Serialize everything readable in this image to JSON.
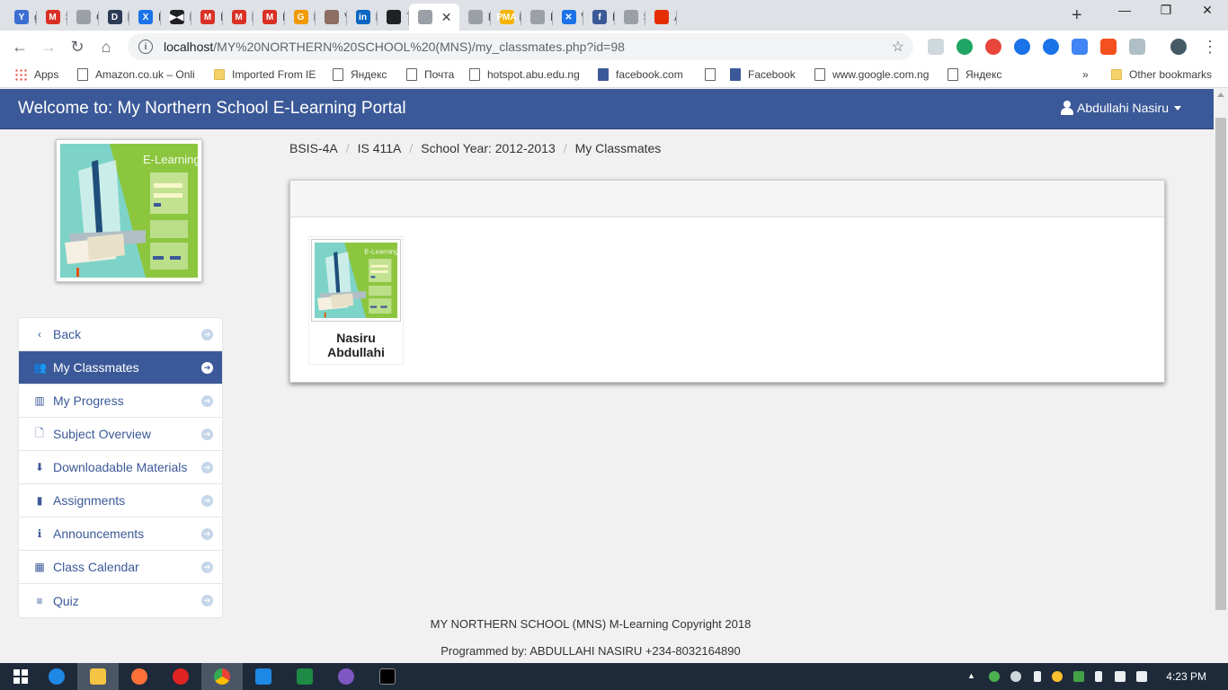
{
  "browser": {
    "tabs": [
      {
        "label": "go",
        "color": "#3c6fd1",
        "glyph": "Y"
      },
      {
        "label": "Se",
        "color": "#d93025",
        "glyph": "M"
      },
      {
        "label": "Gri",
        "color": "#9aa0a6",
        "glyph": ""
      },
      {
        "label": "De",
        "color": "#2b3a55",
        "glyph": "D"
      },
      {
        "label": "Ho",
        "color": "#1a73e8",
        "glyph": "X"
      },
      {
        "label": "Ma",
        "color": "#202124",
        "glyph": "▶◀"
      },
      {
        "label": "Inb",
        "color": "#d93025",
        "glyph": "M"
      },
      {
        "label": "Inb",
        "color": "#d93025",
        "glyph": "M"
      },
      {
        "label": "Inb",
        "color": "#d93025",
        "glyph": "M"
      },
      {
        "label": "Fre",
        "color": "#f29900",
        "glyph": "G"
      },
      {
        "label": "VB",
        "color": "#8d6e63",
        "glyph": ""
      },
      {
        "label": "No",
        "color": "#0a66c2",
        "glyph": "in"
      },
      {
        "label": "To",
        "color": "#202124",
        "glyph": ""
      },
      {
        "label": "",
        "color": "#9aa0a6",
        "glyph": ""
      },
      {
        "label": "log",
        "color": "#9aa0a6",
        "glyph": ""
      },
      {
        "label": "loc",
        "color": "#f4b400",
        "glyph": "PMA"
      },
      {
        "label": "MY",
        "color": "#9aa0a6",
        "glyph": ""
      },
      {
        "label": "WA",
        "color": "#1a73e8",
        "glyph": "✕"
      },
      {
        "label": "Fac",
        "color": "#3b5998",
        "glyph": "f"
      },
      {
        "label": "Sca",
        "color": "#9aa0a6",
        "glyph": ""
      },
      {
        "label": "Ali",
        "color": "#e62e04",
        "glyph": ""
      }
    ],
    "new_tab": "+",
    "minimize": "—",
    "restore": "❐",
    "close": "✕",
    "url_host": "localhost",
    "url_path": "/MY%20NORTHERN%20SCHOOL%20(MNS)/my_classmates.php?id=98",
    "bookmarks": [
      {
        "label": "Apps",
        "kind": "apps"
      },
      {
        "label": "Amazon.co.uk – Onli",
        "kind": "page"
      },
      {
        "label": "Imported From IE",
        "kind": "folder"
      },
      {
        "label": "Яндекс",
        "kind": "page"
      },
      {
        "label": "Почта",
        "kind": "page"
      },
      {
        "label": "hotspot.abu.edu.ng",
        "kind": "page"
      },
      {
        "label": "facebook.com",
        "kind": "fb"
      },
      {
        "label": "",
        "kind": "page"
      },
      {
        "label": "Facebook",
        "kind": "fb"
      },
      {
        "label": "www.google.com.ng",
        "kind": "page"
      },
      {
        "label": "Яндекс",
        "kind": "page"
      }
    ],
    "bookmarks_more": "»",
    "other_bookmarks": "Other bookmarks"
  },
  "header": {
    "brand": "Welcome to: My Northern School E-Learning Portal",
    "user": "Abdullahi Nasiru"
  },
  "sidebar": {
    "items": [
      {
        "label": "Back",
        "icon": "‹",
        "icon_name": "chevron-left-icon"
      },
      {
        "label": "My Classmates",
        "icon": "👥",
        "icon_name": "group-icon",
        "active": true
      },
      {
        "label": "My Progress",
        "icon": "▥",
        "icon_name": "bar-chart-icon"
      },
      {
        "label": "Subject Overview",
        "icon": "🗋",
        "icon_name": "file-icon"
      },
      {
        "label": "Downloadable Materials",
        "icon": "⬇",
        "icon_name": "download-icon"
      },
      {
        "label": "Assignments",
        "icon": "▮",
        "icon_name": "book-icon"
      },
      {
        "label": "Announcements",
        "icon": "ℹ",
        "icon_name": "info-icon"
      },
      {
        "label": "Class Calendar",
        "icon": "▦",
        "icon_name": "calendar-icon"
      },
      {
        "label": "Quiz",
        "icon": "≡",
        "icon_name": "list-icon"
      }
    ],
    "arrow": "➔"
  },
  "breadcrumb": {
    "items": [
      "BSIS-4A",
      "IS 411A",
      "School Year: 2012-2013",
      "My Classmates"
    ],
    "separator": "/"
  },
  "classmates": [
    {
      "name": "Nasiru Abdullahi"
    }
  ],
  "footer": {
    "copyright": "MY NORTHERN SCHOOL (MNS) M-Learning Copyright 2018",
    "programmer": "Programmed by: ABDULLAHI NASIRU +234-8032164890"
  },
  "taskbar": {
    "time": "4:23 PM"
  },
  "colors": {
    "brand": "#3b5998",
    "banner_green": "#8cc63f",
    "banner_teal": "#7dd3c8"
  }
}
